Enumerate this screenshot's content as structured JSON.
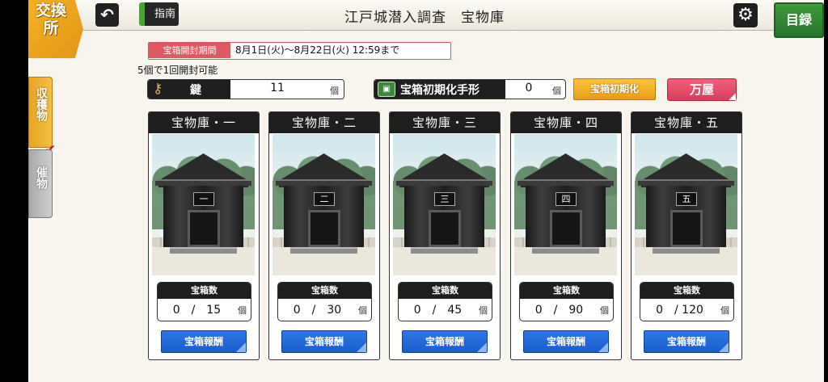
{
  "header": {
    "title": "江戸城潜入調査　宝物庫",
    "guide_label": "指南",
    "back_icon": "back-arrow-icon",
    "settings_icon": "gear-icon",
    "catalog_label": "目録"
  },
  "sidebar": {
    "exchange_label": "交換所",
    "tabs": [
      {
        "label": "収穫物",
        "selected": true
      },
      {
        "label": "催物",
        "selected": false
      }
    ]
  },
  "period": {
    "label": "宝箱開封期間",
    "value": "8月1日(火)～8月22日(火) 12:59まで"
  },
  "open_note": "5個で1回開封可能",
  "keys": {
    "label": "鍵",
    "value": "11",
    "unit": "個",
    "icon": "key-icon"
  },
  "reset_item": {
    "label": "宝箱初期化手形",
    "value": "0",
    "unit": "個",
    "icon": "ticket-icon"
  },
  "buttons": {
    "init_label": "宝箱初期化",
    "yorozuya_label": "万屋"
  },
  "vaults": [
    {
      "title": "宝物庫・一",
      "plaque": "一",
      "count_label": "宝箱数",
      "count": "0　/　15",
      "unit": "個",
      "reward_label": "宝箱報酬"
    },
    {
      "title": "宝物庫・二",
      "plaque": "二",
      "count_label": "宝箱数",
      "count": "0　/　30",
      "unit": "個",
      "reward_label": "宝箱報酬"
    },
    {
      "title": "宝物庫・三",
      "plaque": "三",
      "count_label": "宝箱数",
      "count": "0　/　45",
      "unit": "個",
      "reward_label": "宝箱報酬"
    },
    {
      "title": "宝物庫・四",
      "plaque": "四",
      "count_label": "宝箱数",
      "count": "0　/　90",
      "unit": "個",
      "reward_label": "宝箱報酬"
    },
    {
      "title": "宝物庫・五",
      "plaque": "五",
      "count_label": "宝箱数",
      "count": "0　/ 120",
      "unit": "個",
      "reward_label": "宝箱報酬"
    }
  ],
  "colors": {
    "accent_orange": "#f0a81c",
    "catalog_green": "#2f8a32",
    "reward_blue": "#1f66d6",
    "yorozuya_pink": "#e24d6a",
    "period_red": "#dd5a63"
  }
}
